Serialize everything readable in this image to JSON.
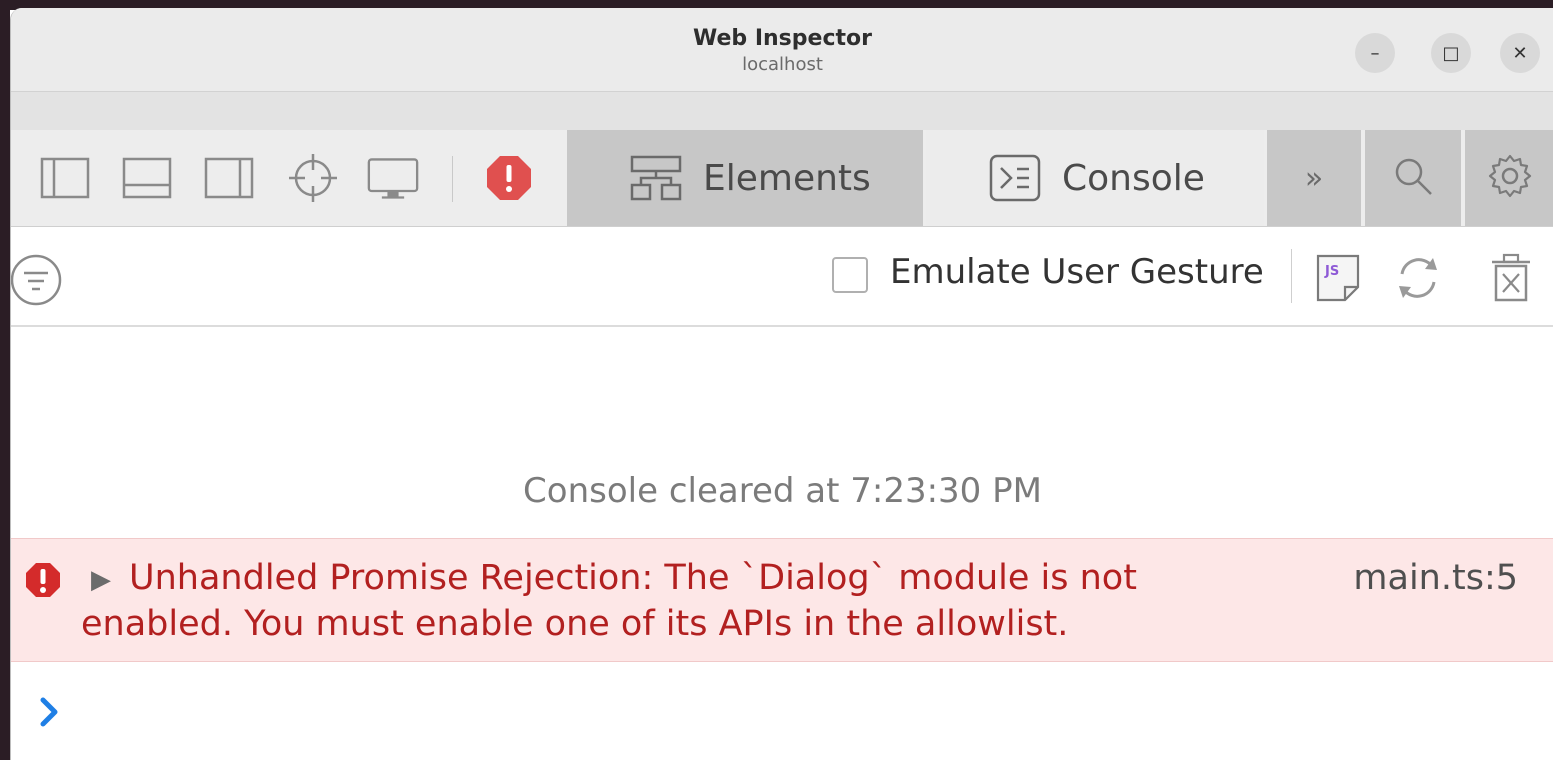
{
  "window": {
    "title": "Web Inspector",
    "subtitle": "localhost",
    "controls": {
      "minimize": "–",
      "maximize": "□",
      "close": "✕"
    }
  },
  "toolbar": {
    "tabs": [
      {
        "label": "Elements",
        "icon": "elements-icon",
        "selected": false
      },
      {
        "label": "Console",
        "icon": "console-icon",
        "selected": true
      }
    ],
    "more_label": "»",
    "icons": [
      "sidebar-left-icon",
      "dock-bottom-icon",
      "dock-right-icon",
      "crosshair-icon",
      "device-icon",
      "error-badge-icon",
      "search-icon",
      "gear-icon"
    ]
  },
  "console_bar": {
    "emulate_label": "Emulate User Gesture",
    "emulate_checked": false,
    "icons": [
      "filter-icon",
      "js-snippet-icon",
      "reload-icon",
      "trash-icon"
    ]
  },
  "console": {
    "cleared_message": "Console cleared at 7:23:30 PM",
    "error": {
      "message": "Unhandled Promise Rejection: The `Dialog` module is not enabled. You must enable one of its APIs in the allowlist.",
      "location": "main.ts:5"
    }
  },
  "colors": {
    "error_text": "#b22020",
    "error_bg": "#fde7e7",
    "prompt": "#1f7fe5",
    "selected_tab": "#ececec"
  }
}
